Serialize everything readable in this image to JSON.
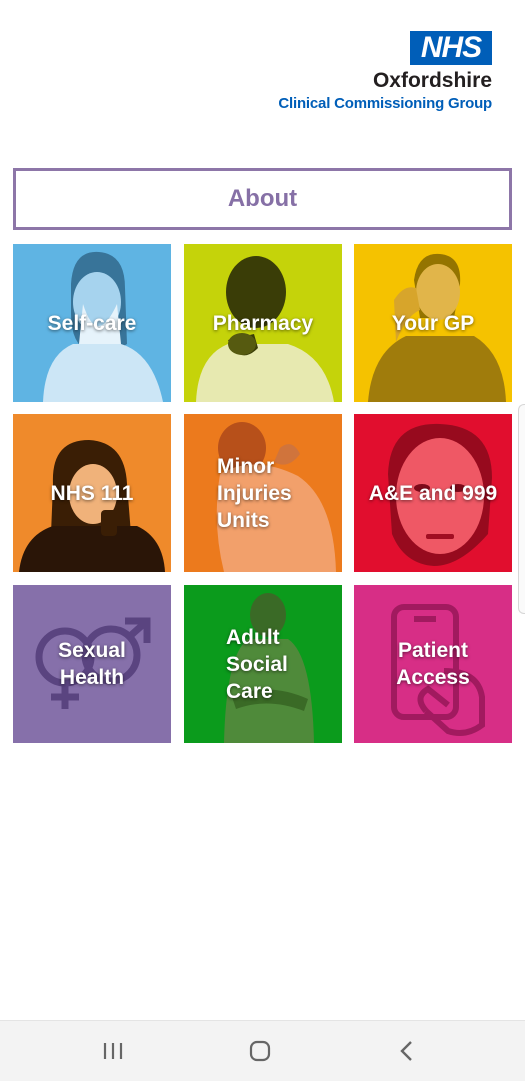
{
  "logo": {
    "badge": "NHS",
    "name": "Oxfordshire",
    "subtitle": "Clinical Commissioning Group",
    "badge_color": "#005EB8"
  },
  "about": {
    "label": "About",
    "color": "#8670a6"
  },
  "tiles": [
    {
      "label": "Self-care",
      "color": "#5fb4e3",
      "icon": "person-sneezing"
    },
    {
      "label": "Pharmacy",
      "color": "#c5d30a",
      "icon": "person-coughing"
    },
    {
      "label": "Your GP",
      "color": "#f5c200",
      "icon": "person-headache"
    },
    {
      "label": "NHS 111",
      "color": "#ef8a2b",
      "icon": "person-phone"
    },
    {
      "label": "Minor\nInjuries\nUnits",
      "color": "#ec7a1d",
      "icon": "person-shoulder-pain"
    },
    {
      "label": "A&E and 999",
      "color": "#e10e2e",
      "icon": "person-face"
    },
    {
      "label": "Sexual\nHealth",
      "color": "#8670aa",
      "icon": "gender-symbols"
    },
    {
      "label": "Adult\nSocial\nCare",
      "color": "#0b9b1c",
      "icon": "person-arms-crossed"
    },
    {
      "label": "Patient\nAccess",
      "color": "#d72e86",
      "icon": "phone-in-hand"
    }
  ],
  "navbar": {
    "recent_icon": "recent-apps-icon",
    "home_icon": "home-icon",
    "back_icon": "back-icon"
  }
}
